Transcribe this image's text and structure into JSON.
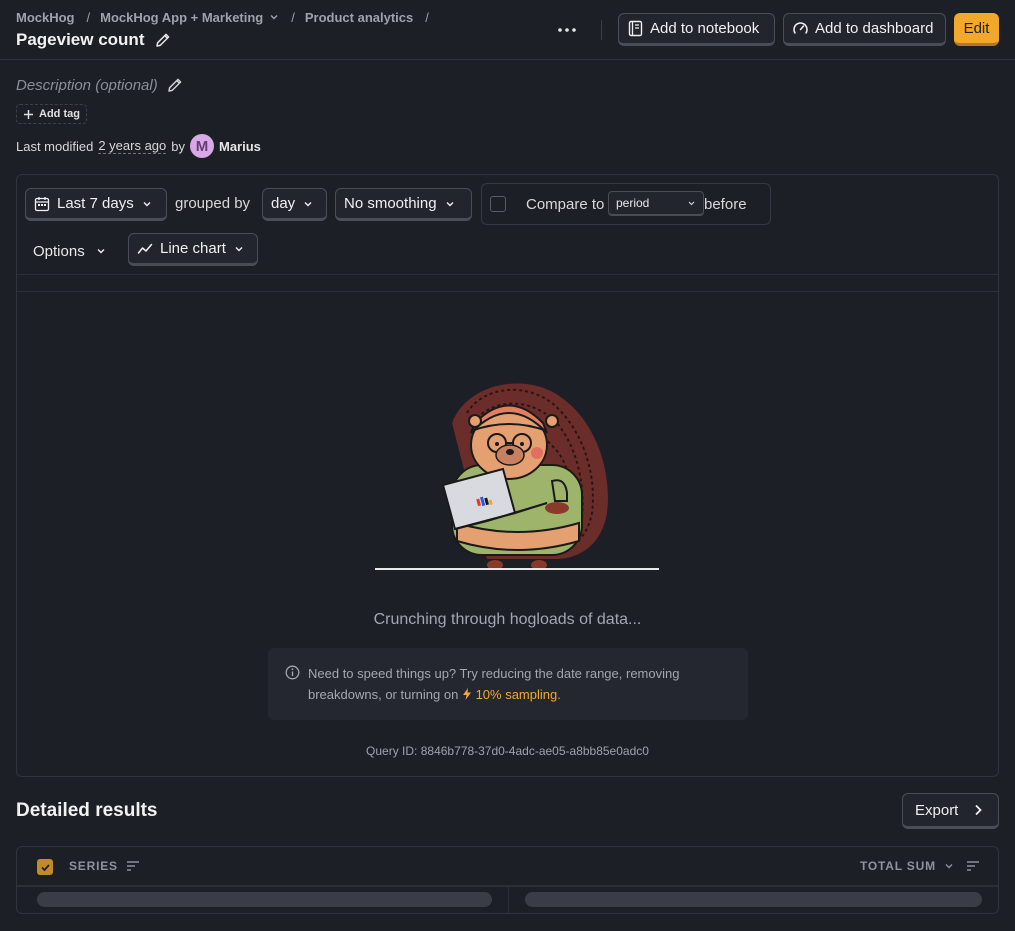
{
  "breadcrumbs": {
    "org": "MockHog",
    "project": "MockHog App + Marketing",
    "section": "Product analytics",
    "separator": "/"
  },
  "title": "Pageview count",
  "actions": {
    "add_to_notebook": "Add to notebook",
    "add_to_dashboard": "Add to dashboard",
    "edit": "Edit"
  },
  "meta": {
    "description_placeholder": "Description (optional)",
    "add_tag": "Add tag",
    "modified_prefix": "Last modified",
    "modified_time": "2 years ago",
    "by": "by",
    "user_initial": "M",
    "user_name": "Marius"
  },
  "filters": {
    "date_range": "Last 7 days",
    "grouped_by_label": "grouped by",
    "interval": "day",
    "smoothing": "No smoothing",
    "compare_to_label": "Compare to",
    "compare_period": "period",
    "compare_suffix": "before",
    "options": "Options",
    "chart_type": "Line chart"
  },
  "loading": {
    "message": "Crunching through hogloads of data...",
    "hint_text": "Need to speed things up? Try reducing the date range, removing breakdowns, or turning on",
    "sampling_link": "10% sampling",
    "hint_end": ".",
    "query_id": "Query ID: 8846b778-37d0-4adc-ae05-a8bb85e0adc0"
  },
  "results": {
    "title": "Detailed results",
    "export": "Export",
    "columns": [
      "SERIES",
      "TOTAL SUM"
    ]
  },
  "colors": {
    "background": "#1d1f27",
    "accent": "#f1a82c",
    "border": "#4a4d59"
  }
}
